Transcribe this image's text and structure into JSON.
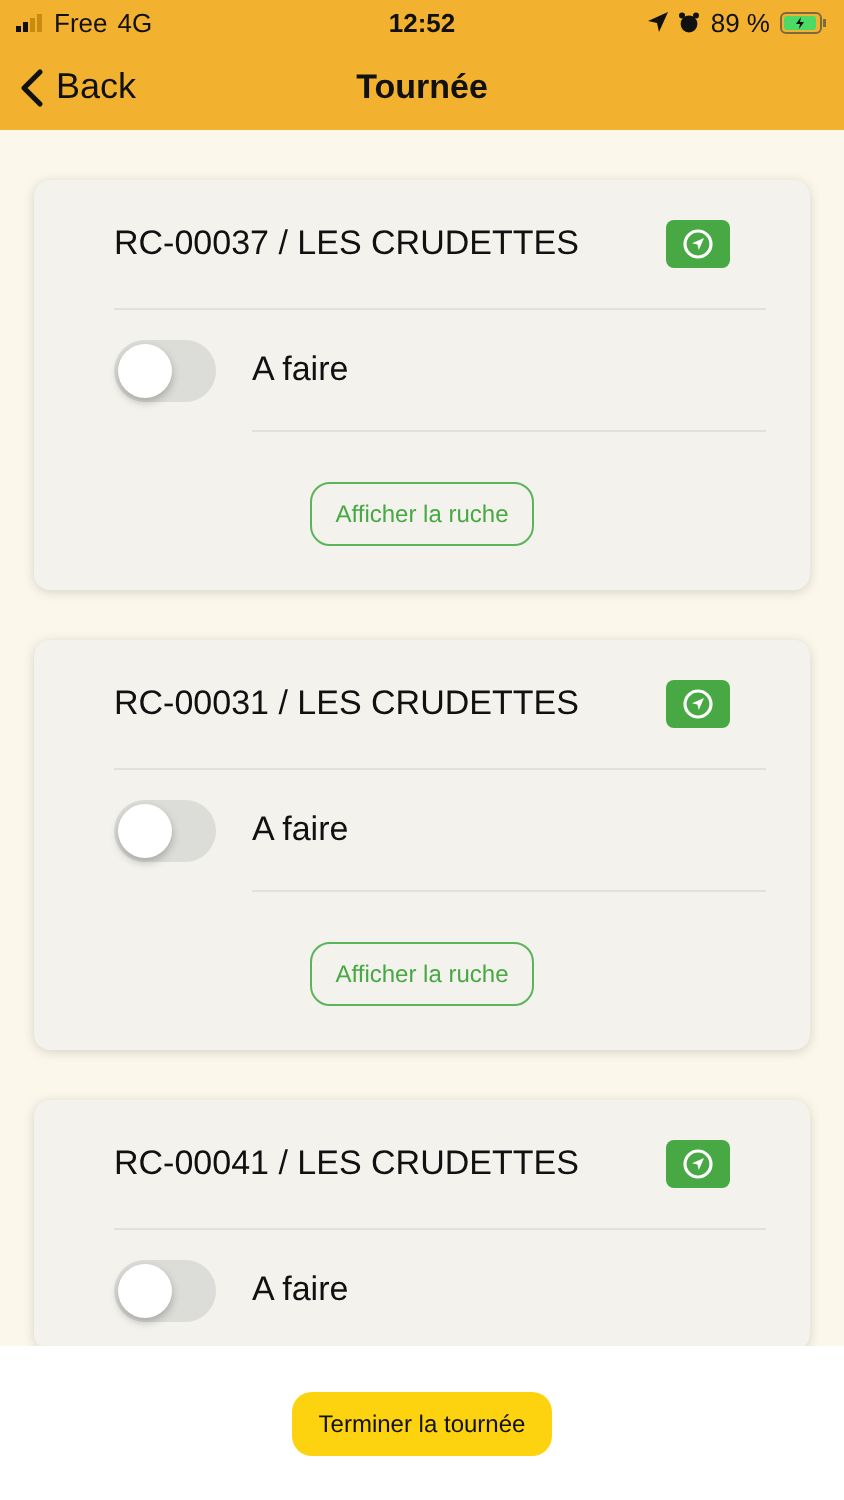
{
  "status_bar": {
    "carrier": "Free",
    "network": "4G",
    "time": "12:52",
    "battery_percent": "89 %"
  },
  "nav": {
    "back": "Back",
    "title": "Tournée"
  },
  "cards": [
    {
      "title": "RC-00037 / LES CRUDETTES",
      "status": "A faire",
      "on": false,
      "button": "Afficher la ruche"
    },
    {
      "title": "RC-00031 / LES CRUDETTES",
      "status": "A faire",
      "on": false,
      "button": "Afficher la ruche"
    },
    {
      "title": "RC-00041 / LES CRUDETTES",
      "status": "A faire",
      "on": false
    }
  ],
  "footer": {
    "button": "Terminer la tournée"
  }
}
